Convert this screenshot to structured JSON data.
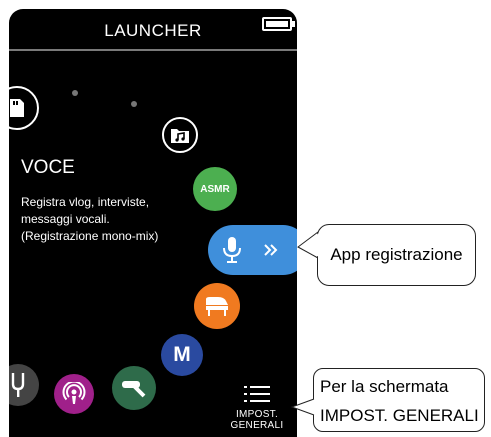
{
  "header": {
    "title": "LAUNCHER"
  },
  "mode": {
    "name": "VOCE",
    "description": [
      "Registra vlog, interviste,",
      "messaggi vocali.",
      "(Registrazione mono-mix)"
    ]
  },
  "apps": {
    "asmr_label": "ASMR",
    "music_label": "M"
  },
  "settings": {
    "label_line1": "IMPOST.",
    "label_line2": "GENERALI"
  },
  "callouts": {
    "recording_app": "App registrazione",
    "settings_line1": "Per la schermata",
    "settings_line2": "IMPOST. GENERALI"
  },
  "colors": {
    "background": "#000000",
    "asmr": "#4caf50",
    "recording": "#3f8fdb",
    "piano": "#f07a20",
    "music": "#2a4aa0",
    "podcast": "#a0208a",
    "boom_mic": "#2e6b4a",
    "tuner": "#444444"
  }
}
